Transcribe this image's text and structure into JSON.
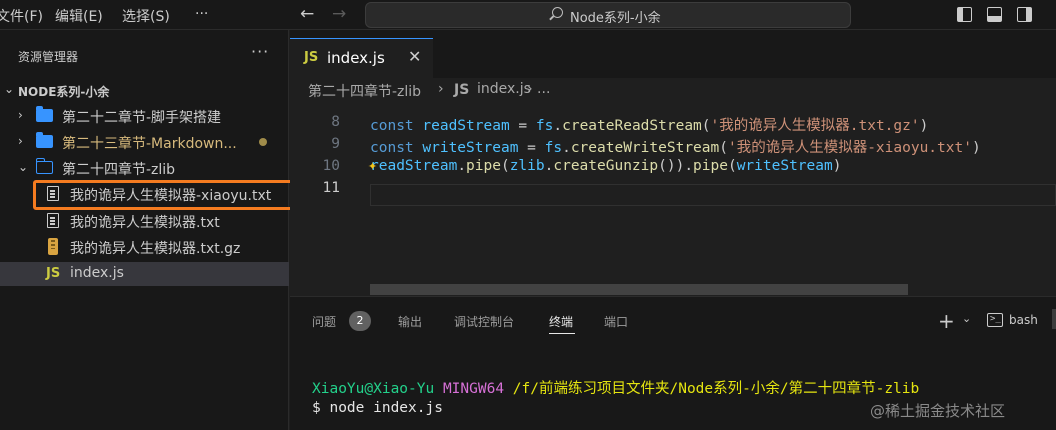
{
  "titlebar": {
    "menu": [
      "文件(F)",
      "编辑(E)",
      "选择(S)",
      "···"
    ],
    "command_center": "Node系列-小余"
  },
  "sidebar": {
    "title": "资源管理器",
    "more": "···",
    "workspace": "NODE系列-小余",
    "items": [
      {
        "label": "第二十二章节-脚手架搭建",
        "kind": "folder",
        "expanded": false
      },
      {
        "label": "第二十三章节-Markdown...",
        "kind": "folder",
        "expanded": false,
        "modified": true
      },
      {
        "label": "第二十四章节-zlib",
        "kind": "folder",
        "expanded": true
      },
      {
        "label": "我的诡异人生模拟器-xiaoyu.txt",
        "kind": "text-file",
        "highlighted": true
      },
      {
        "label": "我的诡异人生模拟器.txt",
        "kind": "text-file"
      },
      {
        "label": "我的诡异人生模拟器.txt.gz",
        "kind": "zip-file"
      },
      {
        "label": "index.js",
        "kind": "js-file",
        "selected": true
      }
    ]
  },
  "editor": {
    "tab": {
      "icon_text": "JS",
      "label": "index.js",
      "close": "✕"
    },
    "breadcrumb": {
      "folder": "第二十四章节-zlib",
      "sep": "›",
      "icon_text": "JS",
      "file": "index.js",
      "tail": "›  ..."
    },
    "lines": [
      {
        "n": "8",
        "tokens": [
          [
            "kw",
            "const "
          ],
          [
            "var",
            "readStream"
          ],
          [
            "plain",
            " = "
          ],
          [
            "var",
            "fs"
          ],
          [
            "plain",
            "."
          ],
          [
            "fn",
            "createReadStream"
          ],
          [
            "plain",
            "("
          ],
          [
            "str",
            "'我的诡异人生模拟器.txt.gz'"
          ],
          [
            "plain",
            ")"
          ]
        ]
      },
      {
        "n": "9",
        "tokens": [
          [
            "kw",
            "const "
          ],
          [
            "var",
            "writeStream"
          ],
          [
            "plain",
            " = "
          ],
          [
            "var",
            "fs"
          ],
          [
            "plain",
            "."
          ],
          [
            "fn",
            "createWriteStream"
          ],
          [
            "plain",
            "("
          ],
          [
            "str",
            "'我的诡异人生模拟器-xiaoyu.txt'"
          ],
          [
            "plain",
            ")"
          ]
        ]
      },
      {
        "n": "10",
        "tokens": [
          [
            "var",
            "readStream"
          ],
          [
            "plain",
            "."
          ],
          [
            "fn",
            "pipe"
          ],
          [
            "plain",
            "("
          ],
          [
            "var",
            "zlib"
          ],
          [
            "plain",
            "."
          ],
          [
            "fn",
            "createGunzip"
          ],
          [
            "plain",
            "())."
          ],
          [
            "fn",
            "pipe"
          ],
          [
            "plain",
            "("
          ],
          [
            "var",
            "writeStream"
          ],
          [
            "plain",
            ")"
          ]
        ]
      },
      {
        "n": "11",
        "tokens": []
      }
    ],
    "lightbulb": "✦"
  },
  "panel": {
    "tabs": [
      "问题",
      "输出",
      "调试控制台",
      "终端",
      "端口"
    ],
    "active_tab": "终端",
    "problems_count": "2",
    "add": "+",
    "dropdown": "⌄",
    "shell": "bash",
    "terminal": {
      "user_host": "XiaoYu@Xiao-Yu",
      "system": "MINGW64",
      "path": "/f/前端练习项目文件夹/Node系列-小余/第二十四章节-zlib",
      "command": "$ node index.js"
    }
  },
  "watermark": "@稀土掘金技术社区",
  "colors": {
    "accent_highlight": "#f47b20",
    "folder": "#3794ff",
    "js": "#cbcb41",
    "keyword": "#569cd6",
    "variable": "#4fc1ff",
    "function": "#dcdcaa",
    "string": "#ce9178"
  }
}
